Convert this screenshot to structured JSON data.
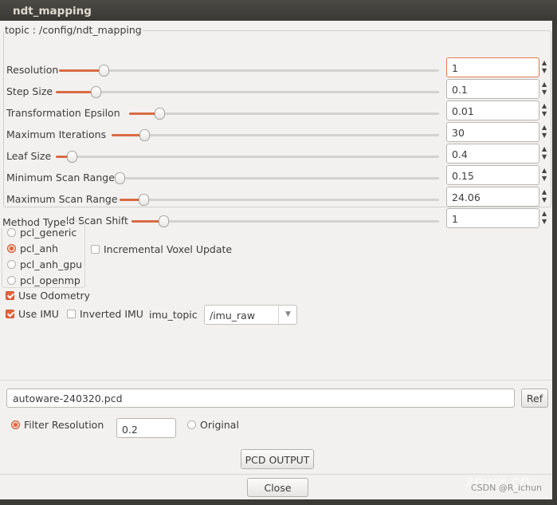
{
  "window": {
    "title": "ndt_mapping"
  },
  "topic_group": {
    "label": "topic : /config/ndt_mapping"
  },
  "params": [
    {
      "label": "Resolution",
      "value": "1"
    },
    {
      "label": "Step Size",
      "value": "0.1"
    },
    {
      "label": "Transformation Epsilon",
      "value": "0.01"
    },
    {
      "label": "Maximum Iterations",
      "value": "30"
    },
    {
      "label": "Leaf Size",
      "value": "0.4"
    },
    {
      "label": "Minimum Scan Range",
      "value": "0.15"
    },
    {
      "label": "Maximum Scan Range",
      "value": "24.06"
    },
    {
      "label": "Minimum Add Scan Shift",
      "value": "1"
    }
  ],
  "method": {
    "label": "Method Type",
    "options": [
      "pcl_generic",
      "pcl_anh",
      "pcl_anh_gpu",
      "pcl_openmp"
    ],
    "selected": "pcl_anh"
  },
  "incremental_voxel": {
    "label": "Incremental Voxel Update",
    "checked": false
  },
  "use_odometry": {
    "label": "Use Odometry",
    "checked": true
  },
  "use_imu": {
    "label": "Use IMU",
    "checked": true
  },
  "inverted_imu": {
    "label": "Inverted IMU",
    "checked": false
  },
  "imu_topic": {
    "label": "imu_topic",
    "value": "/imu_raw"
  },
  "pcd": {
    "filename": "autoware-240320.pcd",
    "ref_label": "Ref",
    "filter_label": "Filter Resolution",
    "filter_value": "0.2",
    "original_label": "Original",
    "output_label": "PCD OUTPUT"
  },
  "close_label": "Close",
  "watermark": {
    "site": "znwx.cn",
    "credit": "CSDN @R_ichun"
  },
  "accent_color": "#e2643a"
}
